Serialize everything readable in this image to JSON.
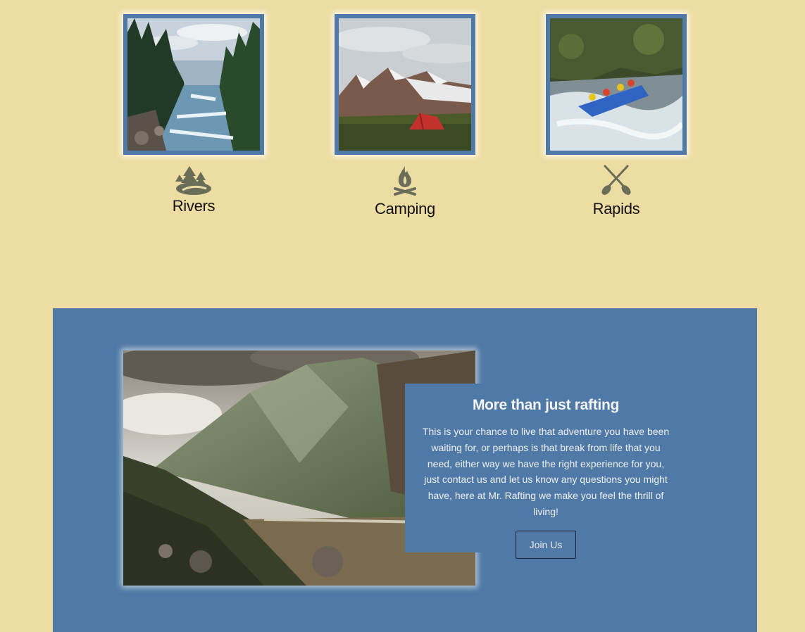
{
  "features": [
    {
      "label": "Rivers",
      "icon": "river-trees-icon",
      "image": "river-photo"
    },
    {
      "label": "Camping",
      "icon": "campfire-icon",
      "image": "mountain-tent-photo"
    },
    {
      "label": "Rapids",
      "icon": "crossed-paddles-icon",
      "image": "rafting-photo"
    }
  ],
  "promo": {
    "title": "More than just rafting",
    "body": "This is your chance to live that adventure you have been waiting for, or perhaps is that break from life that you need, either way we have the right experience for you, just contact us and let us know any questions you might have, here at Mr. Rafting we make you feel the thrill of living!",
    "button_label": "Join Us",
    "image": "mountain-valley-photo"
  },
  "colors": {
    "background": "#eddda2",
    "accent": "#4f79a6",
    "icon": "#6a6e58"
  }
}
